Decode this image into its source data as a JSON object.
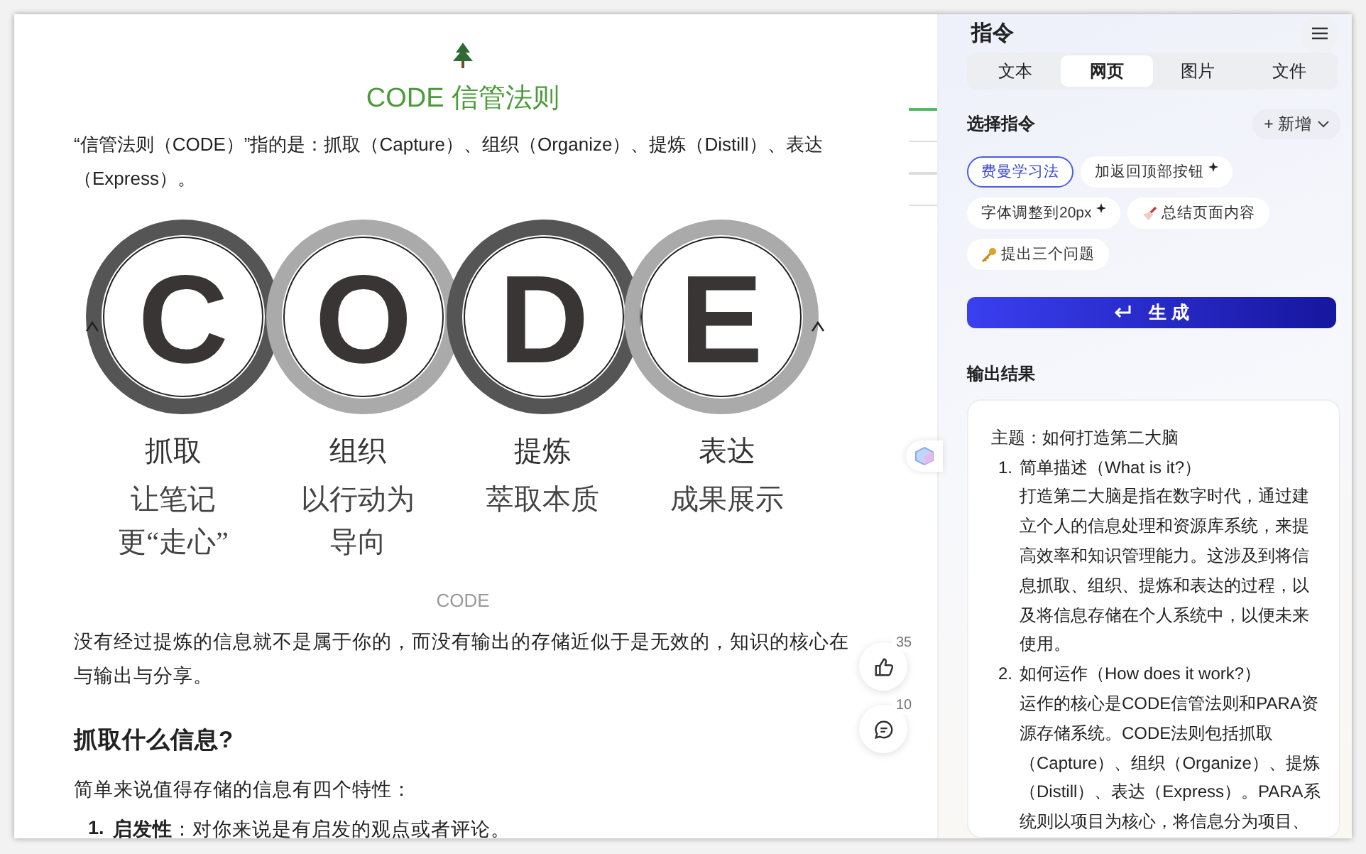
{
  "article": {
    "title": "CODE 信管法则",
    "intro": "“信管法则（CODE）”指的是：抓取（Capture）、组织（Organize）、提炼（Distill）、表达（Express）。",
    "figure": {
      "steps": [
        {
          "letter": "C",
          "label": "抓取",
          "caption": "让笔记更“走心”"
        },
        {
          "letter": "O",
          "label": "组织",
          "caption": "以行动为导向"
        },
        {
          "letter": "D",
          "label": "提炼",
          "caption": "萃取本质"
        },
        {
          "letter": "E",
          "label": "表达",
          "caption": "成果展示"
        }
      ],
      "caption": "CODE"
    },
    "paragraph": "没有经过提炼的信息就不是属于你的，而没有输出的存储近似于是无效的，知识的核心在与输出与分享。",
    "heading": "抓取什么信息?",
    "lead": "简单来说值得存储的信息有四个特性：",
    "list": [
      {
        "number": "1.",
        "text": "**启发性**：对你来说是有启发的观点或者评论。"
      }
    ]
  },
  "outline_markers": [
    {
      "selected": true
    },
    {
      "selected": false
    },
    {
      "selected": false
    },
    {
      "selected": false
    }
  ],
  "reactions": [
    {
      "kind": "like",
      "count": "35"
    },
    {
      "kind": "comment",
      "count": "10"
    }
  ],
  "panel": {
    "title": "指令",
    "tabs": [
      {
        "label": "文本",
        "selected": false
      },
      {
        "label": "网页",
        "selected": true
      },
      {
        "label": "图片",
        "selected": false
      },
      {
        "label": "文件",
        "selected": false
      }
    ],
    "section_title": "选择指令",
    "add_button": "+ 新增",
    "chips": [
      {
        "label": "费曼学习法",
        "selected": true,
        "kind": "plain",
        "starred": false
      },
      {
        "label": "加返回顶部按钮",
        "selected": false,
        "kind": "plain",
        "starred": true
      },
      {
        "label": "字体调整到20px",
        "selected": false,
        "kind": "plain",
        "starred": true
      },
      {
        "label": "总结页面内容",
        "selected": false,
        "kind": "broom",
        "starred": false
      },
      {
        "label": "提出三个问题",
        "selected": false,
        "kind": "key",
        "starred": false
      }
    ],
    "generate_button": "生 成",
    "output_title": "输出结果",
    "output": {
      "topic": "主题：如何打造第二大脑",
      "items": [
        {
          "number": "1.",
          "title": "简单描述（What is it?）",
          "body": "打造第二大脑是指在数字时代，通过建立个人的信息处理和资源库系统，来提高效率和知识管理能力。这涉及到将信息抓取、组织、提炼和表达的过程，以及将信息存储在个人系统中，以便未来使用。"
        },
        {
          "number": "2.",
          "title": "如何运作（How does it work?）",
          "body": "运作的核心是CODE信管法则和PARA资源存储系统。CODE法则包括抓取（Capture）、组织（Organize）、提炼（Distill）、表达（Express）。PARA系统则以项目为核心，将信息分为项目、"
        }
      ]
    }
  }
}
